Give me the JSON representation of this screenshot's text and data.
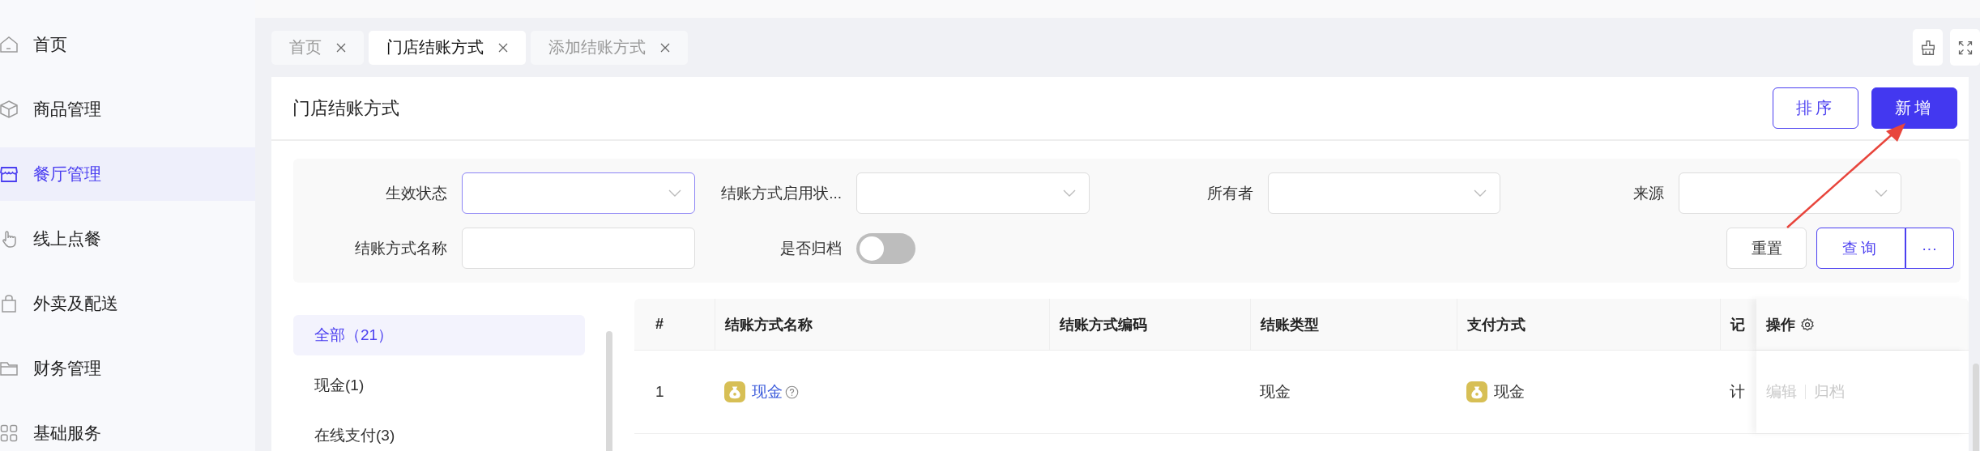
{
  "sidebar": {
    "items": [
      {
        "label": "首页",
        "selected": false
      },
      {
        "label": "商品管理",
        "selected": false
      },
      {
        "label": "餐厅管理",
        "selected": true
      },
      {
        "label": "线上点餐",
        "selected": false
      },
      {
        "label": "外卖及配送",
        "selected": false
      },
      {
        "label": "财务管理",
        "selected": false
      },
      {
        "label": "基础服务",
        "selected": false
      }
    ]
  },
  "tabs": [
    {
      "label": "首页",
      "selected": false
    },
    {
      "label": "门店结账方式",
      "selected": true
    },
    {
      "label": "添加结账方式",
      "selected": false
    }
  ],
  "page": {
    "title": "门店结账方式",
    "buttons": [
      {
        "label": "排序",
        "kind": "outline"
      },
      {
        "label": "新增",
        "kind": "primary"
      }
    ]
  },
  "filters": [
    {
      "label": "生效状态",
      "kind": "select",
      "focused": true
    },
    {
      "label": "结账方式启用状...",
      "kind": "select",
      "focused": false
    },
    {
      "label": "所有者",
      "kind": "select",
      "focused": false
    },
    {
      "label": "来源",
      "kind": "select",
      "focused": false
    },
    {
      "label": "结账方式名称",
      "kind": "input",
      "focused": false
    },
    {
      "label": "是否归档",
      "kind": "toggle",
      "on": false
    }
  ],
  "filter_buttons": [
    {
      "label": "重置",
      "kind": "default"
    },
    {
      "label": "查询",
      "kind": "primary"
    },
    {
      "label": "···",
      "kind": "more"
    }
  ],
  "categories": [
    {
      "label": "全部（21）",
      "selected": true
    },
    {
      "label": "现金(1)",
      "selected": false
    },
    {
      "label": "在线支付(3)",
      "selected": false
    }
  ],
  "table": {
    "columns": [
      "#",
      "结账方式名称",
      "结账方式编码",
      "结账类型",
      "支付方式",
      "记",
      "操作"
    ],
    "rows": [
      {
        "index": "1",
        "name": "现金",
        "settle_type": "现金",
        "pay_method": "现金",
        "column_6": "计",
        "actions": [
          {
            "label": "编辑",
            "disabled": true
          },
          {
            "label": "归档",
            "disabled": true
          }
        ]
      }
    ]
  }
}
